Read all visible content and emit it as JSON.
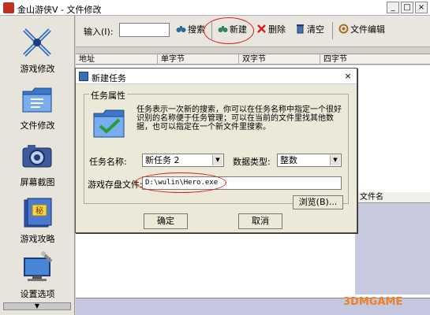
{
  "window": {
    "title": "金山游侠V - 文件修改",
    "minimize": "_",
    "maximize": "□",
    "close": "×"
  },
  "sidebar": {
    "items": [
      {
        "label": "游戏修改",
        "icon": "crossed-swords-icon"
      },
      {
        "label": "文件修改",
        "icon": "folder-icon"
      },
      {
        "label": "屏幕截图",
        "icon": "camera-icon"
      },
      {
        "label": "游戏攻略",
        "icon": "strategy-book-icon"
      },
      {
        "label": "设置选项",
        "icon": "settings-monitor-icon"
      }
    ],
    "scroll_down": "▼"
  },
  "toolbar": {
    "input_label": "输入(I):",
    "input_value": "",
    "search": "搜索",
    "new": "新建",
    "delete": "删除",
    "clear": "清空",
    "file_edit": "文件编辑"
  },
  "table": {
    "headers": [
      "地址",
      "单字节",
      "双字节",
      "四字节"
    ]
  },
  "lower_panel": {
    "header": "文件名"
  },
  "dialog": {
    "title": "新建任务",
    "close": "×",
    "group_label": "任务属性",
    "description": "任务表示一次新的搜索，你可以在任务名称中指定一个很好识别的名称便于任务管理；可以在当前的文件里找其他数据，也可以指定在一个新文件里搜索。",
    "task_name_label": "任务名称:",
    "task_name_value": "新任务 2",
    "data_type_label": "数据类型:",
    "data_type_value": "整数",
    "save_file_label": "游戏存盘文件:",
    "save_file_value": "D:\\wulin\\Hero.exe",
    "browse": "浏览(B)...",
    "ok": "确定",
    "cancel": "取消"
  },
  "watermark": "3DMGAME",
  "colors": {
    "annotation_red": "#d42020",
    "dialog_bg": "#ece9d8",
    "panel_blue": "#c4c7df"
  }
}
